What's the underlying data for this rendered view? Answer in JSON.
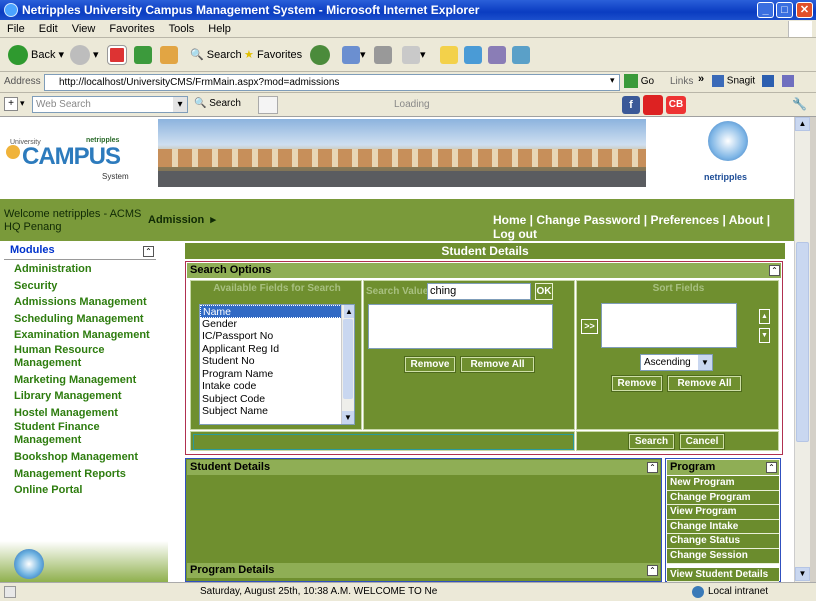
{
  "window": {
    "title": "Netripples University Campus Management System - Microsoft Internet Explorer",
    "minimize": "_",
    "maximize": "□",
    "close": "✕"
  },
  "menubar": [
    "File",
    "Edit",
    "View",
    "Favorites",
    "Tools",
    "Help"
  ],
  "toolbar": {
    "back": "Back",
    "search": "Search",
    "favorites": "Favorites"
  },
  "addressbar": {
    "label": "Address",
    "url": "http://localhost/UniversityCMS/FrmMain.aspx?mod=admissions",
    "go": "Go",
    "links": "Links",
    "snagit": "Snagit"
  },
  "linksbar": {
    "web_search_placeholder": "Web Search",
    "search": "Search",
    "loading": "Loading"
  },
  "header": {
    "logo_small": "University",
    "logo_brand": "netripples",
    "logo_main": "CAMPUS",
    "logo_sub": "System",
    "right_brand": "netripples"
  },
  "navbar": {
    "welcome_line1": "Welcome netripples - ACMS",
    "welcome_line2": "HQ Penang",
    "section": "Admission",
    "links": [
      "Home",
      "Change Password",
      "Preferences",
      "About",
      "Log out"
    ]
  },
  "modules": {
    "title": "Modules",
    "items": [
      "Administration",
      "Security",
      "Admissions Management",
      "Scheduling Management",
      "Examination Management",
      "Human Resource",
      "Management",
      "Marketing Management",
      "Library Management",
      "Hostel Management",
      "Student Finance",
      "Management",
      "Bookshop Management",
      "Management Reports",
      "Online Portal"
    ]
  },
  "main": {
    "title": "Student Details",
    "search_options": {
      "title": "Search Options",
      "available_label": "Available Fields for Search",
      "search_value_label": "Search Value",
      "search_value": "ching",
      "ok": "OK",
      "sort_label": "Sort Fields",
      "fields": [
        "Name",
        "Gender",
        "IC/Passport No",
        "Applicant Reg Id",
        "Student No",
        "Program Name",
        "Intake code",
        "Subject Code",
        "Subject Name"
      ],
      "remove": "Remove",
      "remove_all": "Remove All",
      "move_right": ">>",
      "sort_order": "Ascending",
      "search_btn": "Search",
      "cancel_btn": "Cancel"
    },
    "student_details_panel": "Student Details",
    "program_details_panel": "Program Details"
  },
  "program_panel": {
    "title": "Program",
    "items": [
      "New Program",
      "Change Program",
      "View Program",
      "Change Intake",
      "Change Status",
      "Change Session",
      "View Student Details"
    ]
  },
  "statusbar": {
    "text": "Saturday, August 25th, 10:38 A.M.   WELCOME TO Ne",
    "zone": "Local intranet"
  }
}
